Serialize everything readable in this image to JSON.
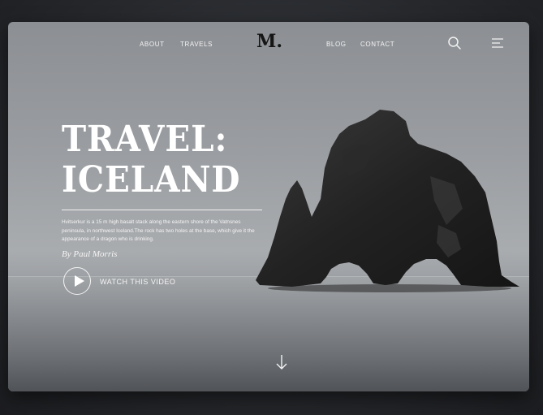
{
  "nav": {
    "left": [
      "ABOUT",
      "TRAVELS"
    ],
    "logo": "M.",
    "right": [
      "BLOG",
      "CONTACT"
    ]
  },
  "icons": {
    "search": "search-icon",
    "menu": "hamburger-menu-icon",
    "scroll": "arrow-down-icon",
    "play": "play-icon"
  },
  "hero": {
    "title_line1": "TRAVEL:",
    "title_line2": "ICELAND",
    "description": "Hvitserkur is a 15 m high basalt stack along the eastern shore of the Vatnsnes peninsula, in northwest Iceland.The rock has two holes at the base, which give it the appearance of a dragon who is drinking.",
    "byline": "By Paul Morris",
    "video_label": "WATCH THIS VIDEO"
  },
  "colors": {
    "text": "#ffffff",
    "logo": "#151515",
    "sky": "#9a9da1",
    "rock": "#1f1f1f"
  }
}
